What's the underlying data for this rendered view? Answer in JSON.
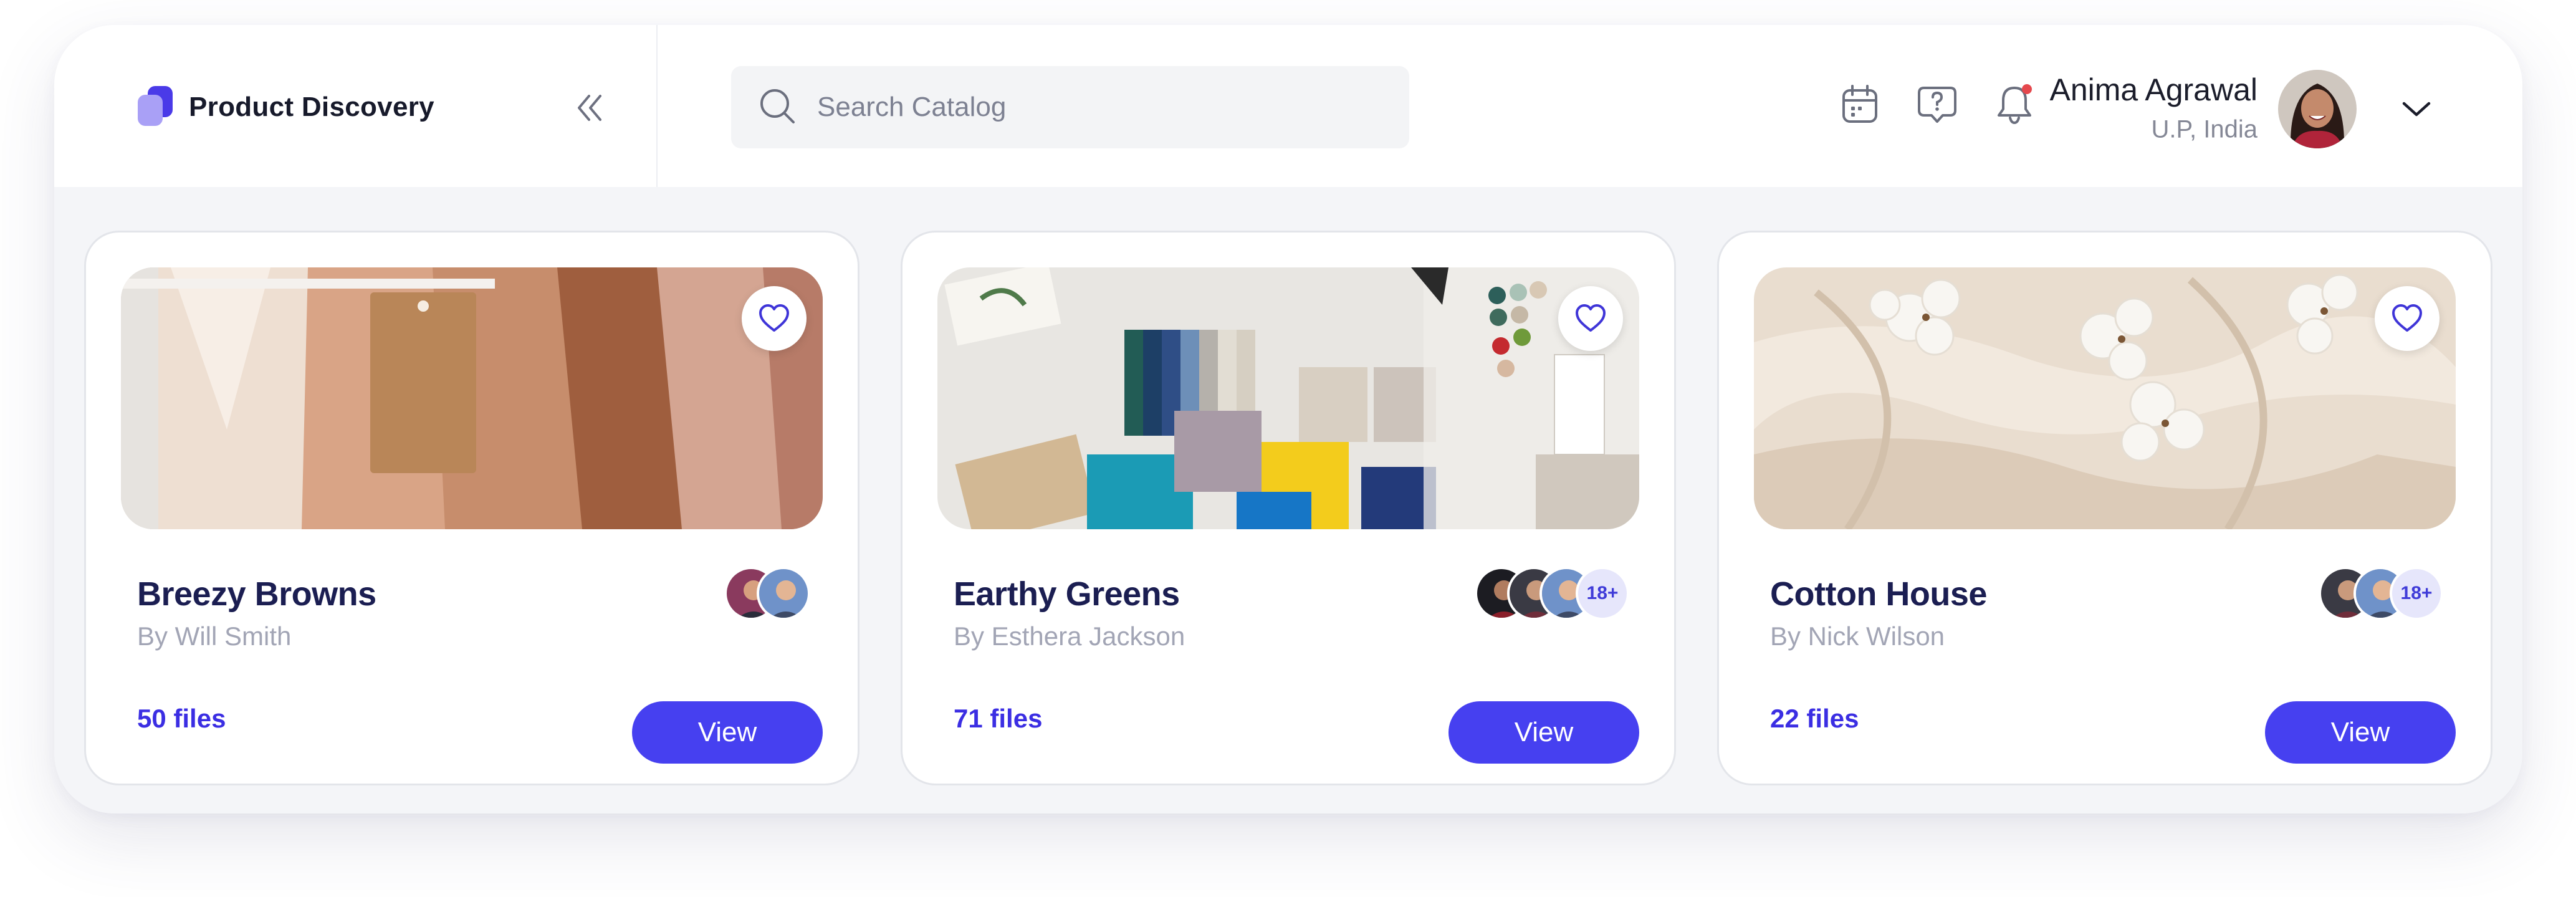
{
  "header": {
    "brand_title": "Product Discovery",
    "brand_icon": "pages-icon",
    "collapse_icon": "double-chevron-left-icon",
    "search": {
      "placeholder": "Search Catalog",
      "value": ""
    },
    "icons": [
      "calendar-icon",
      "help-icon",
      "bell-icon"
    ],
    "notification_dot_color": "#e5484d",
    "user": {
      "name": "Anima Agrawal",
      "location": "U.P, India"
    }
  },
  "cards": [
    {
      "title": "Breezy Browns",
      "author": "By Will Smith",
      "files": "50 files",
      "view_label": "View",
      "members_more": ""
    },
    {
      "title": "Earthy Greens",
      "author": "By Esthera Jackson",
      "files": "71 files",
      "view_label": "View",
      "members_more": "18+"
    },
    {
      "title": "Cotton House",
      "author": "By Nick Wilson",
      "files": "22 files",
      "view_label": "View",
      "members_more": "18+"
    }
  ],
  "colors": {
    "accent": "#4640f0",
    "files_text": "#3b2ee3",
    "title_text": "#1b1e52",
    "app_background": "#f4f5f8"
  }
}
